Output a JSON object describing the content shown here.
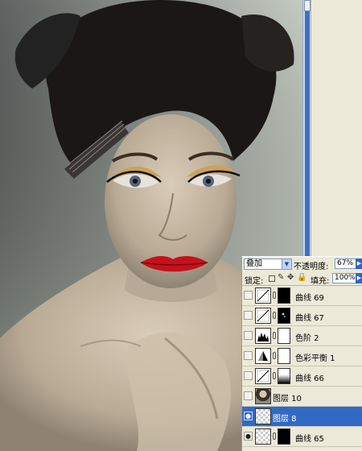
{
  "layers_panel": {
    "blend_mode": "叠加",
    "opacity_label": "不透明度:",
    "opacity_value": "67%",
    "lock_label": "锁定:",
    "fill_label": "填充:",
    "fill_value": "100%",
    "layers": [
      {
        "name": "曲线 69",
        "kind": "curves-icon",
        "mask": "black",
        "selected": false,
        "visible": false
      },
      {
        "name": "曲线 67",
        "kind": "curves-icon",
        "mask": "black-with-spots",
        "selected": false,
        "visible": false
      },
      {
        "name": "色阶 2",
        "kind": "levels-icon",
        "mask": "white",
        "selected": false,
        "visible": false
      },
      {
        "name": "色彩平衡 1",
        "kind": "color-balance-icon",
        "mask": "white",
        "selected": false,
        "visible": false
      },
      {
        "name": "曲线 66",
        "kind": "curves-icon",
        "mask": "white-to-black",
        "selected": false,
        "visible": false
      },
      {
        "name": "图层 10",
        "kind": "photo-thumbnail",
        "mask": "",
        "selected": false,
        "visible": false
      },
      {
        "name": "图层 8",
        "kind": "transparent-thumbnail",
        "mask": "",
        "selected": true,
        "visible": true
      },
      {
        "name": "曲线 65",
        "kind": "transparent-thumbnail",
        "mask": "black",
        "selected": false,
        "visible": true
      }
    ]
  },
  "colors": {
    "selection": "#316ac5",
    "panel_bg": "#ece9d8",
    "scrollbar": "#3e6fc8",
    "lips": "#c4121a"
  }
}
